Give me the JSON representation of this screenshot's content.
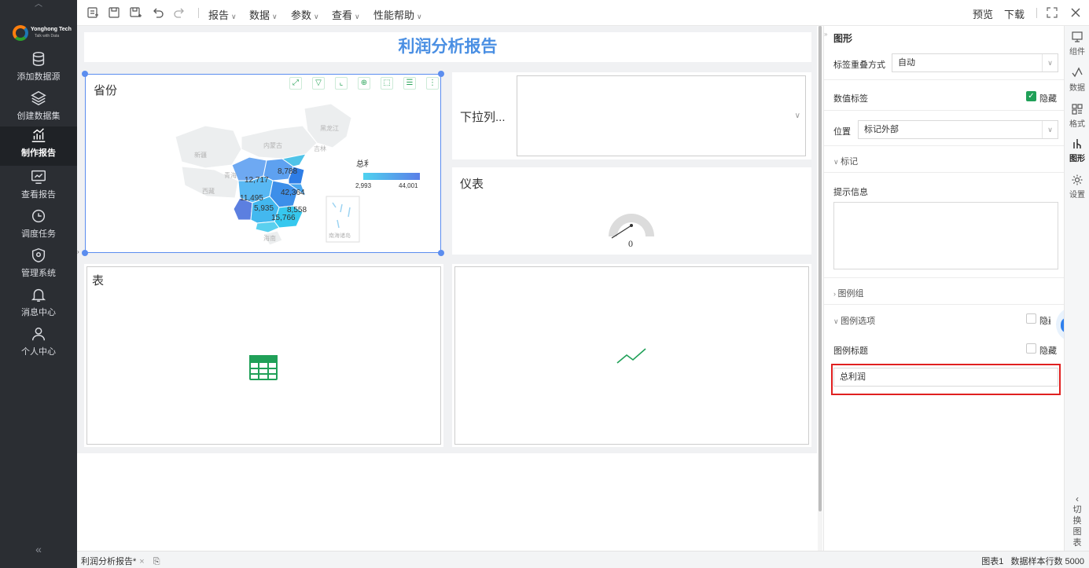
{
  "nav": {
    "logo_brand": "Yonghong Tech",
    "logo_tagline": "Talk with Data",
    "items": [
      {
        "label": "添加数据源",
        "icon": "database-icon"
      },
      {
        "label": "创建数据集",
        "icon": "layers-icon"
      },
      {
        "label": "制作报告",
        "icon": "report-chart-icon",
        "active": true
      },
      {
        "label": "查看报告",
        "icon": "view-report-icon"
      },
      {
        "label": "调度任务",
        "icon": "schedule-icon"
      },
      {
        "label": "管理系统",
        "icon": "shield-settings-icon"
      },
      {
        "label": "消息中心",
        "icon": "bell-icon"
      },
      {
        "label": "个人中心",
        "icon": "user-icon"
      }
    ],
    "collapse_glyph": "«"
  },
  "toolbar": {
    "menus": [
      "报告",
      "数据",
      "参数",
      "查看",
      "性能帮助"
    ],
    "preview": "预览",
    "download": "下载"
  },
  "report": {
    "title": "利润分析报告",
    "map_card": {
      "title": "省份",
      "legend_title": "总利润",
      "legend_min": "2,993",
      "legend_max": "44,001",
      "labels": [
        "8,788",
        "12,717",
        "42,364",
        "11,495",
        "5,935",
        "8,558",
        "15,766"
      ],
      "provinces": [
        "黑龙江",
        "内蒙古",
        "吉林",
        "新疆",
        "青海",
        "西藏",
        "海南",
        "南海诸岛"
      ]
    },
    "dropdown_card": {
      "title": "下拉列..."
    },
    "gauge_card": {
      "title": "仪表",
      "value": "0"
    },
    "table_card": {
      "title": "表"
    }
  },
  "panel": {
    "section_title": "图形",
    "label_overlap": {
      "label": "标签重叠方式",
      "value": "自动"
    },
    "value_label": {
      "label": "数值标签",
      "checkbox_label": "隐藏",
      "checked": true
    },
    "position": {
      "label": "位置",
      "value": "标记外部"
    },
    "marker_section": "标记",
    "tooltip_label": "提示信息",
    "legend_group": "图例组",
    "legend_options": {
      "label": "图例选项",
      "checkbox_label": "隐藏"
    },
    "legend_title": {
      "label": "图例标题",
      "checkbox_label": "隐藏"
    },
    "legend_title_value": "总利润"
  },
  "right_tabs": [
    {
      "label": "组件",
      "icon": "component-icon"
    },
    {
      "label": "数据",
      "icon": "data-icon"
    },
    {
      "label": "格式",
      "icon": "format-icon"
    },
    {
      "label": "图形",
      "icon": "graph-icon",
      "active": true
    },
    {
      "label": "设置",
      "icon": "gear-icon"
    }
  ],
  "switch_chart": [
    "切",
    "换",
    "图",
    "表"
  ],
  "statusbar": {
    "tab": "利润分析报告*",
    "chart_name": "图表1",
    "sample_rows": "数据样本行数 5000"
  },
  "colors": {
    "accent": "#4a8fe3",
    "green": "#20a058",
    "highlight": "#e02020"
  }
}
